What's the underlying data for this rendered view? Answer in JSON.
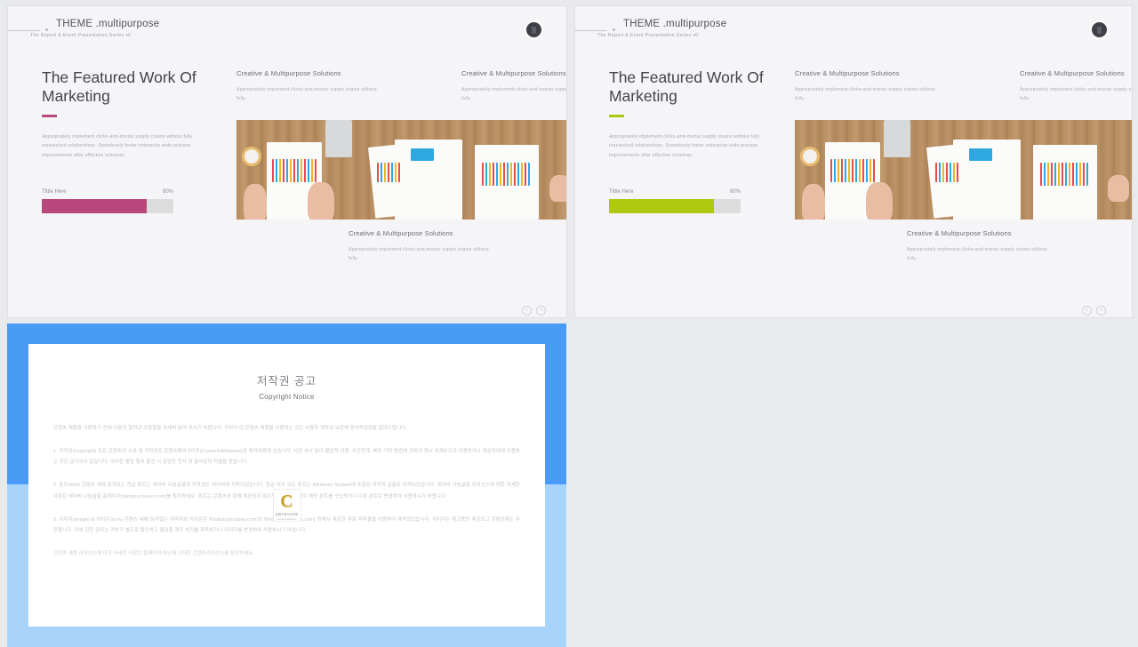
{
  "slides": [
    {
      "brand_prefix": "THEME",
      "brand_suffix": ".multipurpose",
      "subtitle": "The Report & Event Presentation Series v0",
      "title": "The Featured Work Of Marketing",
      "body": "Appropriately implement clicks-and-mortar supply chains without fully researched relationships. Seamlessly foster enterprise-wide process improvements after effective schemas.",
      "accent": "#b8487b",
      "bar": {
        "label": "Tittle Here",
        "percent": "80%",
        "value": 80,
        "track": "#dcdcdc"
      },
      "cards": [
        {
          "heading": "Creative & Multipurpose Solutions",
          "text": "Appropriately implement clicks-and-mortar supply chains without fully."
        },
        {
          "heading": "Creative & Multipurpose Solutions",
          "text": "Appropriately implement clicks-and-mortar supply chains without fully."
        },
        {
          "heading": "Creative & Multipurpose Solutions",
          "text": "Appropriately implement clicks-and-mortar supply chains without fully."
        }
      ],
      "nav": {
        "prev": "‹",
        "next": "›"
      }
    },
    {
      "brand_prefix": "THEME",
      "brand_suffix": ".multipurpose",
      "subtitle": "The Report & Event Presentation Series v0",
      "title": "The Featured Work Of Marketing",
      "body": "Appropriately implement clicks-and-mortar supply chains without fully researched relationships. Seamlessly foster enterprise-wide process improvements after effective schemas.",
      "accent": "#aec80f",
      "bar": {
        "label": "Tittle Here",
        "percent": "80%",
        "value": 80,
        "track": "#dcdcdc"
      },
      "cards": [
        {
          "heading": "Creative & Multipurpose Solutions",
          "text": "Appropriately implement clicks-and-mortar supply chains without fully."
        },
        {
          "heading": "Creative & Multipurpose Solutions",
          "text": "Appropriately implement clicks-and-mortar supply chains without fully."
        },
        {
          "heading": "Creative & Multipurpose Solutions",
          "text": "Appropriately implement clicks-and-mortar supply chains without fully."
        }
      ],
      "nav": {
        "prev": "‹",
        "next": "›"
      }
    }
  ],
  "copyright": {
    "frame_color_top": "#4a9bf5",
    "frame_color_bottom": "#a8d4fb",
    "title_ko": "저작권 공고",
    "title_en": "Copyright Notice",
    "paragraphs": [
      "콘텐츠 제품을 사용하기 전에 다음의 협약과 조항들을 자세히 읽어 주시기 바랍니다. 귀하가 이 콘텐츠 제품을 사용하는 것은 사용자 계약과 보증에 동의하셨음을 알려드립니다.",
      "1. 저작권(copyright) 모든 콘텐츠의 소유 및 저작권은 콘텐츠메이크아웃(ContentsMakeout)과 제작자에게 있습니다. 사진 승낙 없이 물업적 이용, 무단전재, 배포 기타 방법에 의하여 명시 복제본으로 이용하거나 제삼자에게 이용하는 것은 금지되어 있습니다. 이러한 불법 행위 발견 시 준엄한 민사 및 형사상의 처벌을 받습니다.",
      "2. 폰트(font) 콘텐츠 내에 담겨있는 한글 폰트는 네이버 나눔글꼴의 저작권은 네이버에 저작되었습니다. 한글 외의 모든 폰트는 Windows System에 포함된 저작적 글꼴로 저작되었습니다. 네이버 나눔글꼴 라이선스에 대한 자세한 사항은 네이버 나눔글꼴 홈페이지(hangeul.naver.com)를 참조하세요. 폰트는 콘텐츠와 함께 제공되지 않으므로, 필요할 경우 해당 폰트를 구입하거나 다른 폰트로 변경하여 사용하시기 바랍니다.",
      "3. 이미지(image) & 아이콘(icon) 콘텐츠 내에 담겨있는 이미지와 아이콘은 Pixabay(pixabay.com)와 Webalys(webalys.com) 등에서 제공한 무료 저작물을 이용하여 제작되었습니다. 이미지는 참고용만 제공되고 콘텐츠에는 무관합니다. 이에 관한 권리는 귀하가 별도로 확인하고 필요할 경우 허가를 취득하거나 이미지를 변경하여 사용하시기 바랍니다.",
      "콘텐츠 제품 라이선스에 대한 자세한 사항은 홈페이지 하단에 기재한 콘텐츠라이선스를 참조하세요."
    ],
    "watermark": {
      "letter": "C",
      "line1": "콘텐츠메이크아웃",
      "line2": "ContentsMakeout"
    }
  }
}
